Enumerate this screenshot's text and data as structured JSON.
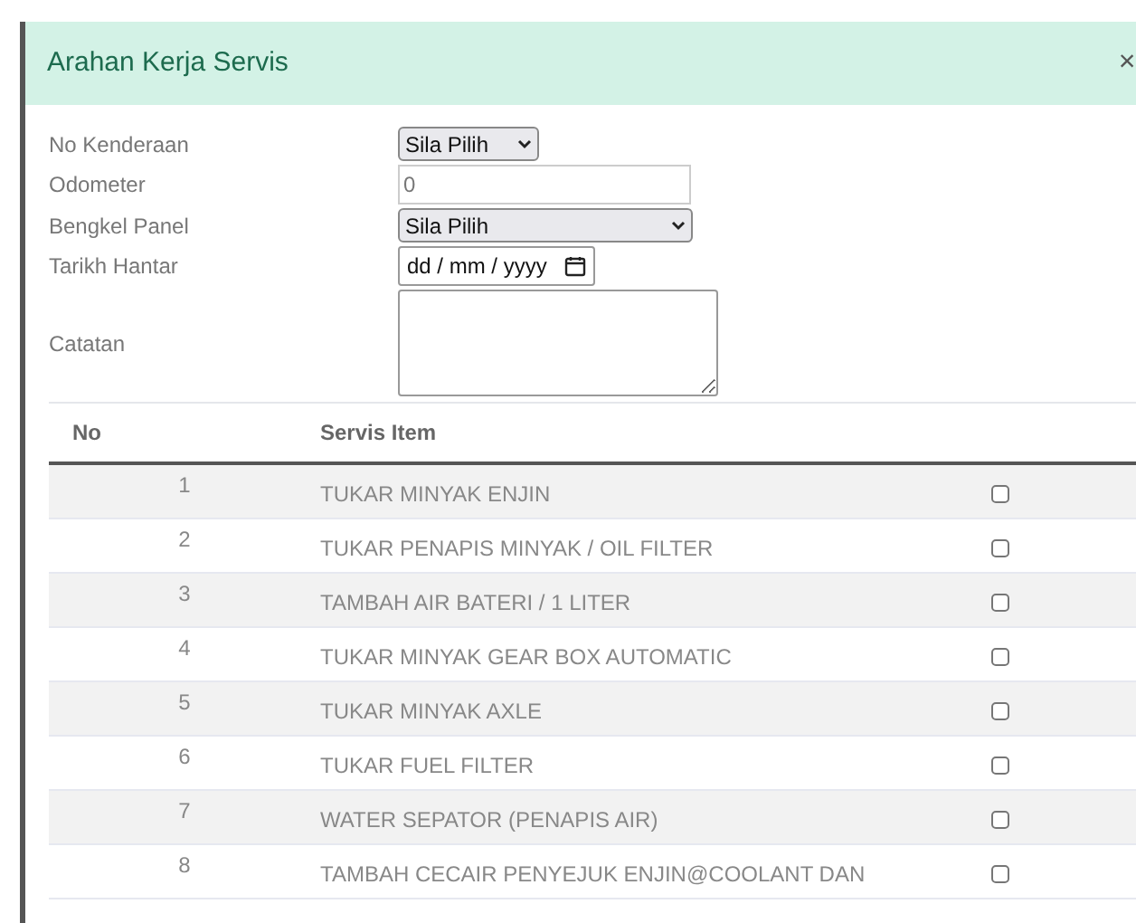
{
  "dialog": {
    "title": "Arahan Kerja Servis",
    "close": "×"
  },
  "form": {
    "fields": [
      {
        "kind": "select",
        "label": "No Kenderaan",
        "value": "Sila Pilih"
      },
      {
        "kind": "text",
        "label": "Odometer",
        "placeholder": "0"
      },
      {
        "kind": "select_wide",
        "label": "Bengkel Panel",
        "value": "Sila Pilih"
      },
      {
        "kind": "date",
        "label": "Tarikh Hantar",
        "value": "dd / mm / yyyy"
      },
      {
        "kind": "textarea",
        "label": "Catatan"
      }
    ]
  },
  "table": {
    "columns": [
      "No",
      "Servis Item"
    ],
    "rows": [
      {
        "no": "1",
        "item": "TUKAR MINYAK ENJIN",
        "checked": false
      },
      {
        "no": "2",
        "item": "TUKAR PENAPIS MINYAK / OIL FILTER",
        "checked": false
      },
      {
        "no": "3",
        "item": "TAMBAH AIR BATERI / 1 LITER",
        "checked": false
      },
      {
        "no": "4",
        "item": "TUKAR MINYAK GEAR BOX AUTOMATIC",
        "checked": false
      },
      {
        "no": "5",
        "item": "TUKAR MINYAK AXLE",
        "checked": false
      },
      {
        "no": "6",
        "item": "TUKAR FUEL FILTER",
        "checked": false
      },
      {
        "no": "7",
        "item": "WATER SEPATOR (PENAPIS AIR)",
        "checked": false
      },
      {
        "no": "8",
        "item": "TAMBAH CECAIR PENYEJUK ENJIN@COOLANT DAN",
        "checked": false
      }
    ]
  }
}
